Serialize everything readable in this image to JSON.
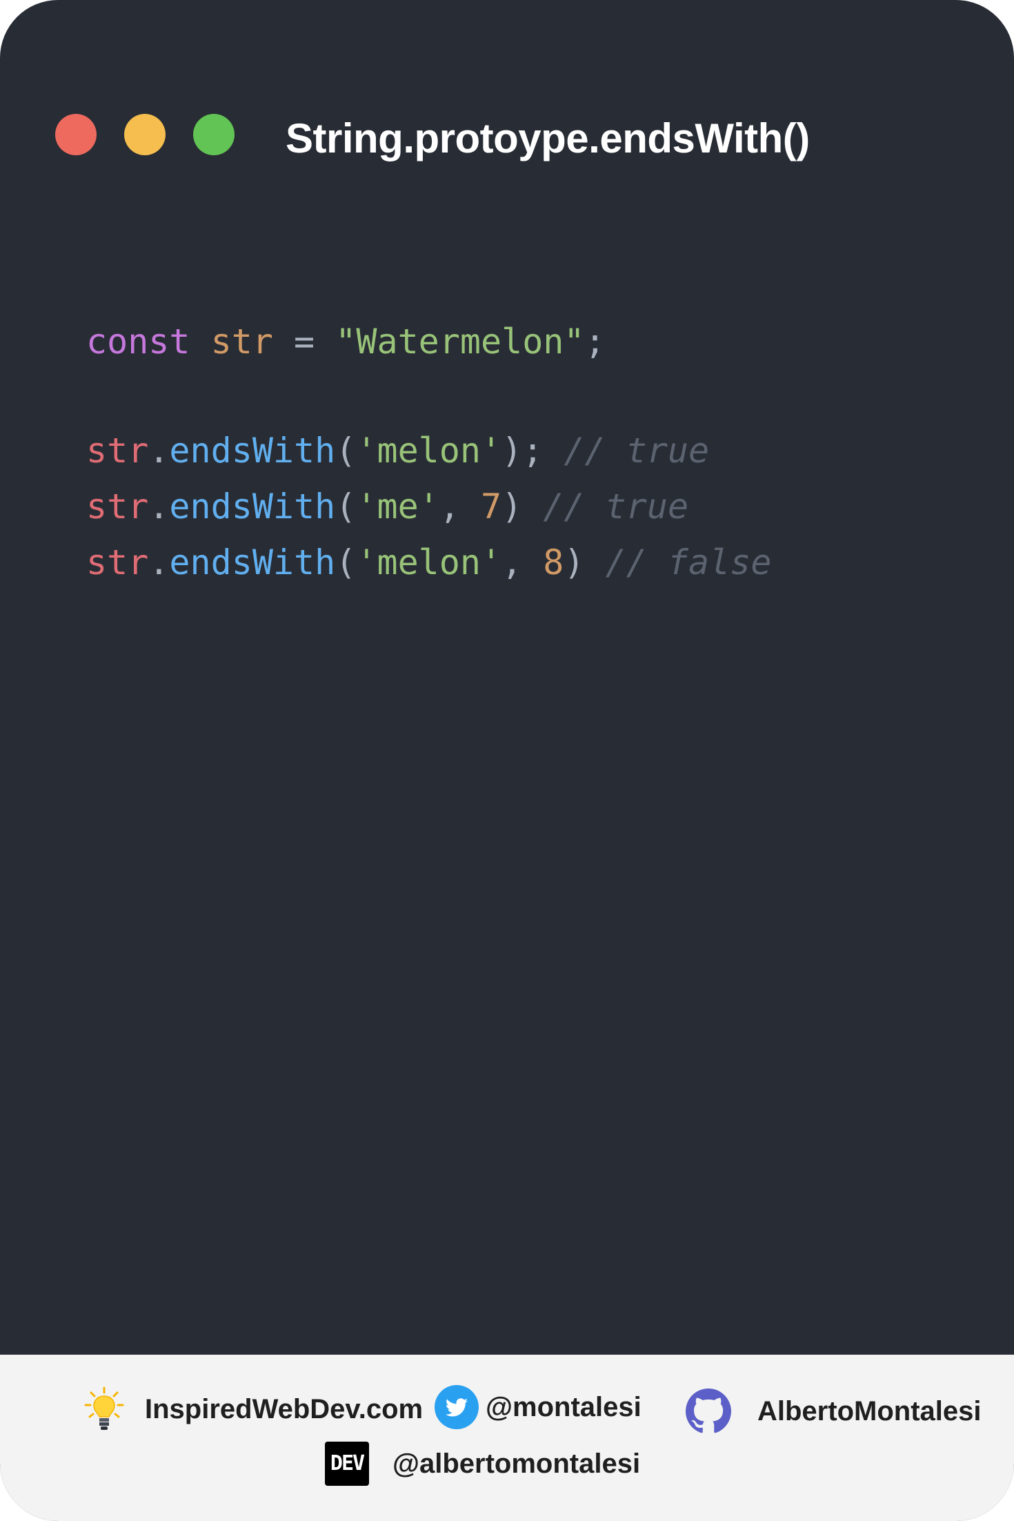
{
  "window": {
    "title": "String.protoype.endsWith()",
    "controls": [
      {
        "name": "close",
        "color": "#ee6a5f"
      },
      {
        "name": "minimize",
        "color": "#f5be4f"
      },
      {
        "name": "maximize",
        "color": "#62c454"
      }
    ]
  },
  "code": {
    "line1": {
      "keyword": "const",
      "var": "str",
      "op": "=",
      "value": "\"Watermelon\"",
      "end": ";"
    },
    "line2": {
      "obj": "str",
      "dot": ".",
      "method": "endsWith",
      "open": "(",
      "arg": "'melon'",
      "close": ");",
      "comment": "// true"
    },
    "line3": {
      "obj": "str",
      "dot": ".",
      "method": "endsWith",
      "open": "(",
      "arg": "'me'",
      "comma": ",",
      "num": "7",
      "close": ")",
      "comment": "// true"
    },
    "line4": {
      "obj": "str",
      "dot": ".",
      "method": "endsWith",
      "open": "(",
      "arg": "'melon'",
      "comma": ",",
      "num": "8",
      "close": ")",
      "comment": "// false"
    }
  },
  "footer": {
    "website": {
      "icon": "lightbulb-icon",
      "text": "InspiredWebDev.com"
    },
    "twitter": {
      "icon": "twitter-icon",
      "text": "@montalesi"
    },
    "github": {
      "icon": "github-icon",
      "text": "AlbertoMontalesi"
    },
    "dev": {
      "icon": "dev-icon",
      "badge": "DEV",
      "text": "@albertomontalesi"
    }
  },
  "colors": {
    "background": "#282c34",
    "footer": "#f3f3f3",
    "keyword": "#c678dd",
    "string": "#98c379",
    "function": "#61afef",
    "variable": "#e06c75",
    "number": "#d19a66",
    "comment": "#5c6370",
    "twitter": "#1da1f2",
    "github": "#5b5fc7"
  }
}
